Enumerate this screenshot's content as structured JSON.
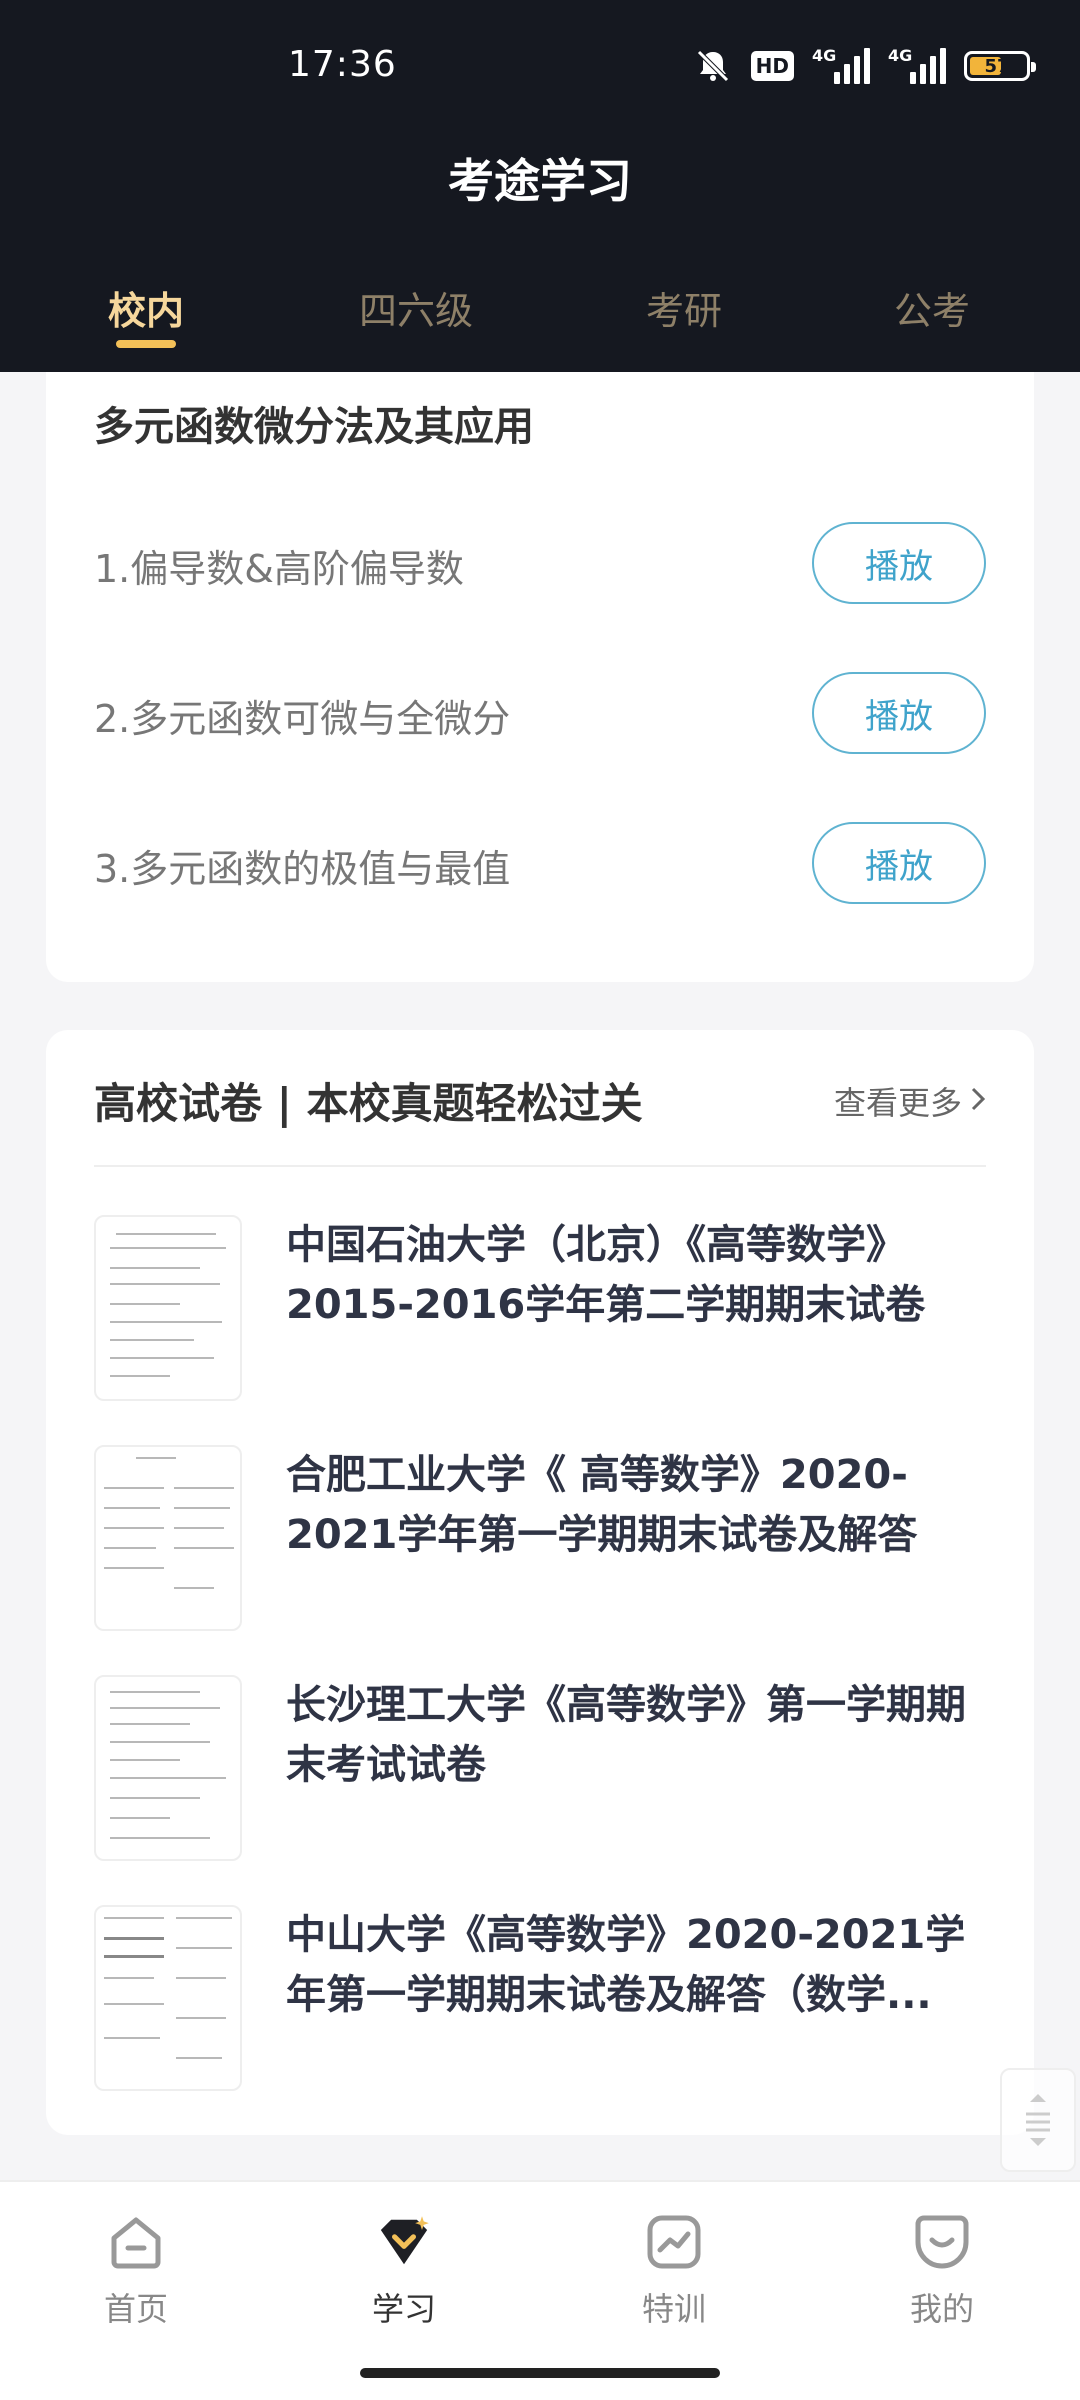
{
  "status_bar": {
    "time": "17:36",
    "hd_label": "HD",
    "net1": "4G",
    "net2": "4G",
    "battery": "57"
  },
  "app": {
    "title": "考途学习"
  },
  "tabs": [
    {
      "label": "校内",
      "active": true
    },
    {
      "label": "四六级",
      "active": false
    },
    {
      "label": "考研",
      "active": false
    },
    {
      "label": "公考",
      "active": false
    }
  ],
  "course": {
    "title": "多元函数微分法及其应用",
    "lessons": [
      {
        "label": "1.偏导数&高阶偏导数",
        "button": "播放"
      },
      {
        "label": "2.多元函数可微与全微分",
        "button": "播放"
      },
      {
        "label": "3.多元函数的极值与最值",
        "button": "播放"
      }
    ]
  },
  "papers": {
    "title": "高校试卷 | 本校真题轻松过关",
    "more": "查看更多",
    "items": [
      {
        "title": "中国石油大学（北京）《高等数学》2015-2016学年第二学期期末试卷"
      },
      {
        "title": "合肥工业大学《 高等数学》2020-2021学年第一学期期末试卷及解答"
      },
      {
        "title": "长沙理工大学《高等数学》第一学期期末考试试卷"
      },
      {
        "title": "中山大学《高等数学》2020-2021学年第一学期期末试卷及解答（数学..."
      }
    ]
  },
  "bottom_nav": [
    {
      "label": "首页",
      "icon": "home-icon",
      "active": false
    },
    {
      "label": "学习",
      "icon": "study-icon",
      "active": true
    },
    {
      "label": "特训",
      "icon": "training-icon",
      "active": false
    },
    {
      "label": "我的",
      "icon": "profile-icon",
      "active": false
    }
  ],
  "colors": {
    "header_bg": "#151820",
    "tab_active": "#f6d79c",
    "tab_indicator": "#f3c058",
    "play_button": "#3fa3cb"
  }
}
